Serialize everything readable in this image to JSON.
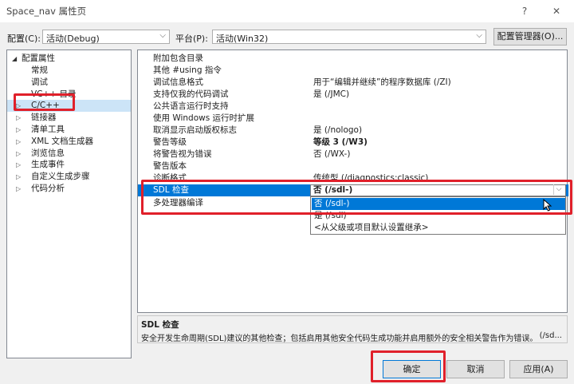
{
  "window": {
    "title": "Space_nav 属性页",
    "help_glyph": "?",
    "close_glyph": "✕"
  },
  "config_bar": {
    "config_label": "配置(C):",
    "config_value": "活动(Debug)",
    "platform_label": "平台(P):",
    "platform_value": "活动(Win32)",
    "manager_button": "配置管理器(O)..."
  },
  "tree": {
    "root": "配置属性",
    "items": [
      {
        "label": "常规",
        "expandable": false
      },
      {
        "label": "调试",
        "expandable": false
      },
      {
        "label": "VC++ 目录",
        "expandable": false
      },
      {
        "label": "C/C++",
        "expandable": true,
        "selected": true
      },
      {
        "label": "链接器",
        "expandable": true
      },
      {
        "label": "清单工具",
        "expandable": true
      },
      {
        "label": "XML 文档生成器",
        "expandable": true
      },
      {
        "label": "浏览信息",
        "expandable": true
      },
      {
        "label": "生成事件",
        "expandable": true
      },
      {
        "label": "自定义生成步骤",
        "expandable": true
      },
      {
        "label": "代码分析",
        "expandable": true
      }
    ]
  },
  "properties": {
    "rows": [
      {
        "name": "附加包含目录",
        "value": ""
      },
      {
        "name": "其他 #using 指令",
        "value": ""
      },
      {
        "name": "调试信息格式",
        "value": "用于“编辑并继续”的程序数据库 (/ZI)"
      },
      {
        "name": "支持仅我的代码调试",
        "value": "是 (/JMC)"
      },
      {
        "name": "公共语言运行时支持",
        "value": ""
      },
      {
        "name": "使用 Windows 运行时扩展",
        "value": ""
      },
      {
        "name": "取消显示启动版权标志",
        "value": "是 (/nologo)"
      },
      {
        "name": "警告等级",
        "value": "等级 3 (/W3)",
        "bold": true
      },
      {
        "name": "将警告视为错误",
        "value": "否 (/WX-)"
      },
      {
        "name": "警告版本",
        "value": ""
      },
      {
        "name": "诊断格式",
        "value": "传统型 (/diagnostics:classic)"
      }
    ],
    "selected_row": {
      "name": "SDL 检查",
      "value": "否 (/sdl-)"
    },
    "after_row": {
      "name": "多处理器编译",
      "value": ""
    },
    "dropdown_options": [
      "否 (/sdl-)",
      "是 (/sdl)",
      "<从父级或项目默认设置继承>"
    ]
  },
  "description": {
    "title": "SDL 检查",
    "text": "安全开发生命周期(SDL)建议的其他检查；包括启用其他安全代码生成功能并启用额外的安全相关警告作为错误。",
    "suffix": "(/sd..."
  },
  "buttons": {
    "ok": "确定",
    "cancel": "取消",
    "apply": "应用(A)"
  },
  "colors": {
    "highlight": "#0078d7",
    "annotation_red": "#e0202a"
  }
}
